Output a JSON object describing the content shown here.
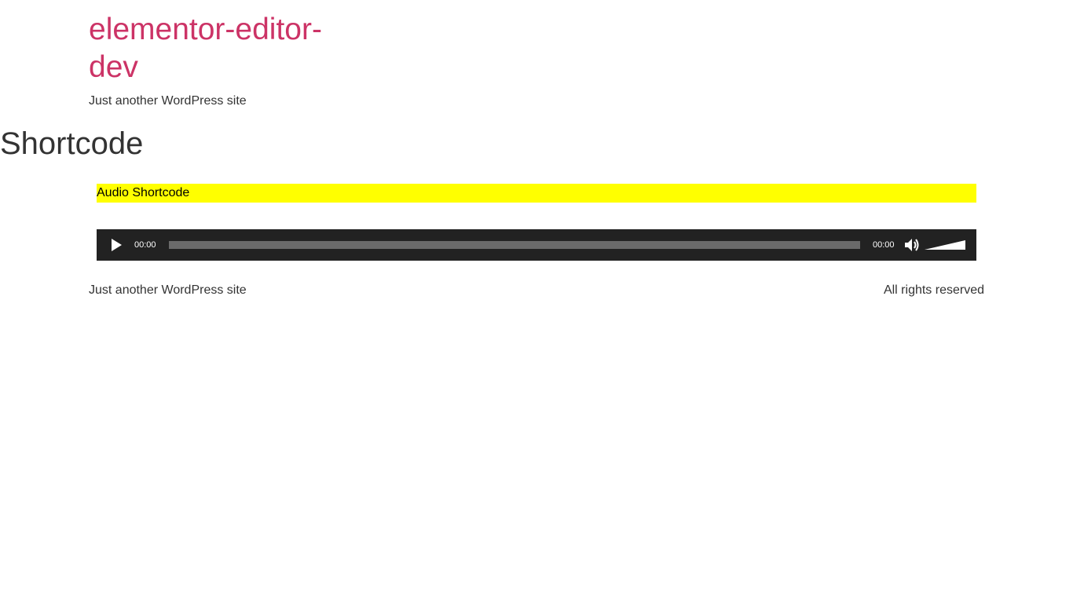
{
  "header": {
    "site_title_line1": "elementor-editor-",
    "site_title_line2": "dev",
    "site_description": "Just another WordPress site"
  },
  "page": {
    "title": "Shortcode"
  },
  "content": {
    "shortcode_label": "Audio Shortcode"
  },
  "audio_player": {
    "current_time": "00:00",
    "duration": "00:00",
    "progress_fraction": 0,
    "volume_fraction": 1,
    "play_icon": "play-icon",
    "mute_icon": "volume-icon"
  },
  "footer": {
    "description": "Just another WordPress site",
    "copyright": "All rights reserved"
  },
  "colors": {
    "accent": "#cc3366",
    "highlight": "#ffff00",
    "player_bg": "#222222",
    "text": "#333333"
  }
}
